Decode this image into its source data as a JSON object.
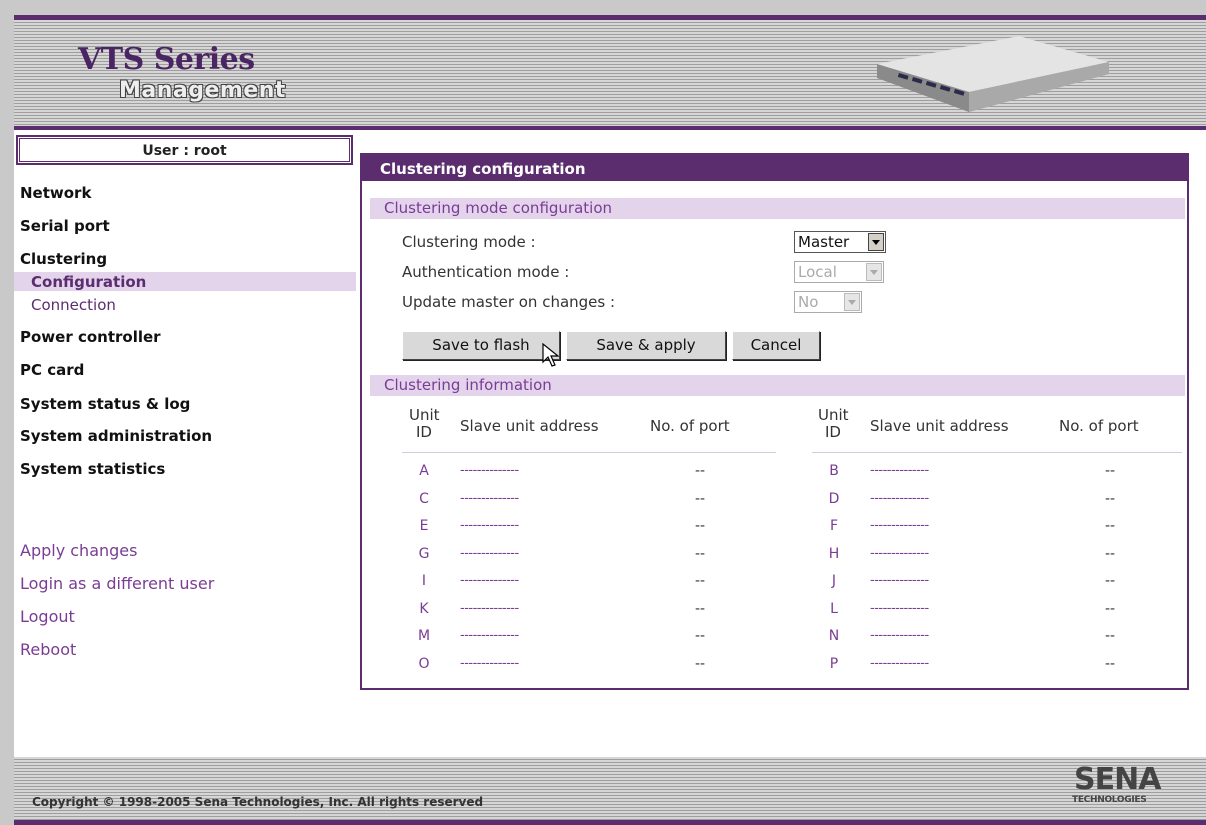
{
  "header": {
    "brand_title": "VTS Series",
    "brand_subtitle": "Management",
    "device_image": "vts-device-image"
  },
  "sidebar": {
    "user_label": "User : root",
    "nav": [
      {
        "label": "Network"
      },
      {
        "label": "Serial port"
      },
      {
        "label": "Clustering"
      },
      {
        "label": "Power controller"
      },
      {
        "label": "PC card"
      },
      {
        "label": "System status & log"
      },
      {
        "label": "System administration"
      },
      {
        "label": "System statistics"
      }
    ],
    "clustering_sub": [
      {
        "label": "Configuration",
        "active": true
      },
      {
        "label": "Connection"
      }
    ],
    "links": [
      {
        "label": "Apply changes"
      },
      {
        "label": "Login as a different user"
      },
      {
        "label": "Logout"
      },
      {
        "label": "Reboot"
      }
    ]
  },
  "panel": {
    "title": "Clustering configuration",
    "mode_section": "Clustering mode configuration",
    "fields": {
      "clustering_mode_label": "Clustering mode :",
      "clustering_mode_value": "Master",
      "auth_mode_label": "Authentication mode :",
      "auth_mode_value": "Local",
      "update_master_label": "Update master on changes :",
      "update_master_value": "No"
    },
    "buttons": {
      "save_flash": "Save to flash",
      "save_apply": "Save & apply",
      "cancel": "Cancel"
    },
    "info_section": "Clustering information",
    "table": {
      "headers": {
        "unit_id_line1": "Unit",
        "unit_id_line2": "ID",
        "address": "Slave unit address",
        "ports": "No. of port"
      },
      "rows": [
        {
          "left": {
            "id": "A",
            "address": "--------------",
            "ports": "--"
          },
          "right": {
            "id": "B",
            "address": "--------------",
            "ports": "--"
          }
        },
        {
          "left": {
            "id": "C",
            "address": "--------------",
            "ports": "--"
          },
          "right": {
            "id": "D",
            "address": "--------------",
            "ports": "--"
          }
        },
        {
          "left": {
            "id": "E",
            "address": "--------------",
            "ports": "--"
          },
          "right": {
            "id": "F",
            "address": "--------------",
            "ports": "--"
          }
        },
        {
          "left": {
            "id": "G",
            "address": "--------------",
            "ports": "--"
          },
          "right": {
            "id": "H",
            "address": "--------------",
            "ports": "--"
          }
        },
        {
          "left": {
            "id": "I",
            "address": "--------------",
            "ports": "--"
          },
          "right": {
            "id": "J",
            "address": "--------------",
            "ports": "--"
          }
        },
        {
          "left": {
            "id": "K",
            "address": "--------------",
            "ports": "--"
          },
          "right": {
            "id": "L",
            "address": "--------------",
            "ports": "--"
          }
        },
        {
          "left": {
            "id": "M",
            "address": "--------------",
            "ports": "--"
          },
          "right": {
            "id": "N",
            "address": "--------------",
            "ports": "--"
          }
        },
        {
          "left": {
            "id": "O",
            "address": "--------------",
            "ports": "--"
          },
          "right": {
            "id": "P",
            "address": "--------------",
            "ports": "--"
          }
        }
      ]
    }
  },
  "footer": {
    "copyright": "Copyright © 1998-2005 Sena Technologies, Inc. All rights reserved",
    "logo_main": "SENA",
    "logo_sub": "TECHNOLOGIES"
  },
  "colors": {
    "accent": "#5b2d6e",
    "section_bg": "#e3d4ec",
    "link": "#7a3c94"
  }
}
